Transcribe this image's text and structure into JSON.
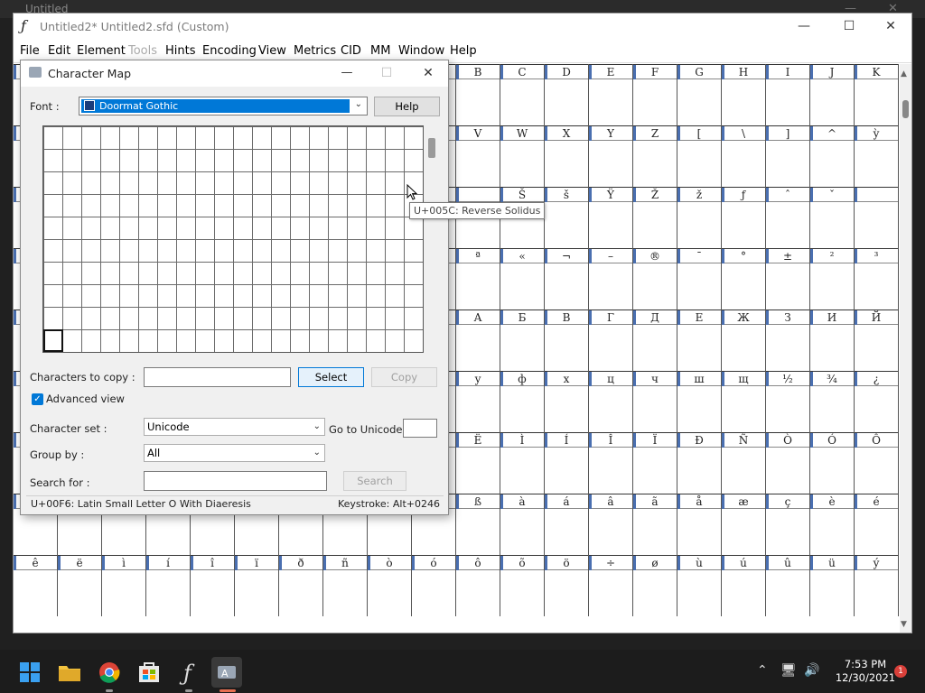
{
  "background_window": {
    "title": "Untitled"
  },
  "fontforge": {
    "title": "Untitled2*  Untitled2.sfd (Custom)",
    "menu": [
      "File",
      "Edit",
      "Element",
      "Tools",
      "Hints",
      "Encoding",
      "View",
      "Metrics",
      "CID",
      "MM",
      "Window",
      "Help"
    ],
    "disabled_menu": [
      "Tools"
    ],
    "glyph_rows": [
      [
        "",
        "",
        "",
        "",
        "",
        "",
        "",
        "",
        "",
        "",
        "B",
        "C",
        "D",
        "E",
        "F",
        "G",
        "H",
        "I",
        "J",
        "K"
      ],
      [
        "",
        "",
        "",
        "",
        "",
        "",
        "",
        "",
        "",
        "",
        "V",
        "W",
        "X",
        "Y",
        "Z",
        "[",
        "\\",
        "]",
        "^",
        "ỳ"
      ],
      [
        "",
        "",
        "",
        "",
        "",
        "",
        "",
        "",
        "",
        "",
        "",
        "Š",
        "š",
        "Ÿ",
        "Ž",
        "ž",
        "ƒ",
        "ˆ",
        "ˇ",
        ""
      ],
      [
        "",
        "",
        "",
        "",
        "",
        "",
        "",
        "",
        "",
        "",
        "ª",
        "«",
        "¬",
        "–",
        "®",
        "¯",
        "°",
        "±",
        "²",
        "³"
      ],
      [
        "",
        "",
        "",
        "",
        "",
        "",
        "",
        "",
        "",
        "",
        "А",
        "Б",
        "В",
        "Г",
        "Д",
        "Е",
        "Ж",
        "З",
        "И",
        "Й"
      ],
      [
        "",
        "",
        "",
        "",
        "",
        "",
        "",
        "",
        "",
        "",
        "у",
        "ф",
        "х",
        "ц",
        "ч",
        "ш",
        "щ",
        "½",
        "¾",
        "¿"
      ],
      [
        "",
        "",
        "",
        "",
        "",
        "",
        "",
        "",
        "",
        "",
        "Ë",
        "Ì",
        "Í",
        "Î",
        "Ï",
        "Ð",
        "Ñ",
        "Ò",
        "Ó",
        "Ô"
      ],
      [
        "",
        "",
        "",
        "",
        "",
        "",
        "",
        "",
        "",
        "",
        "ß",
        "à",
        "á",
        "â",
        "ã",
        "å",
        "æ",
        "ç",
        "è",
        "é"
      ],
      [
        "ê",
        "ë",
        "ì",
        "í",
        "î",
        "ï",
        "ð",
        "ñ",
        "ò",
        "ó",
        "ô",
        "õ",
        "ö",
        "÷",
        "ø",
        "ù",
        "ú",
        "û",
        "ü",
        "ý"
      ]
    ],
    "header_color": "#4a6fb0"
  },
  "charmap": {
    "title": "Character Map",
    "font_label": "Font :",
    "font_value": "Doormat Gothic",
    "help_button": "Help",
    "chars_to_copy_label": "Characters to copy :",
    "chars_to_copy_value": "",
    "select_button": "Select",
    "copy_button": "Copy",
    "advanced_view_label": "Advanced view",
    "advanced_view_checked": true,
    "charset_label": "Character set :",
    "charset_value": "Unicode",
    "goto_unicode_label": "Go to Unicode :",
    "goto_unicode_value": "",
    "groupby_label": "Group by :",
    "groupby_value": "All",
    "search_label": "Search for :",
    "search_value": "",
    "search_button": "Search",
    "status_left": "U+00F6: Latin Small Letter O With Diaeresis",
    "status_right": "Keystroke: Alt+0246",
    "tooltip": "U+005C: Reverse Solidus",
    "accent_color": "#0078d7"
  },
  "taskbar": {
    "time": "7:53 PM",
    "date": "12/30/2021",
    "notification_count": "1",
    "apps": [
      "start",
      "file-explorer",
      "chrome",
      "store",
      "fontforge",
      "charmap"
    ]
  }
}
